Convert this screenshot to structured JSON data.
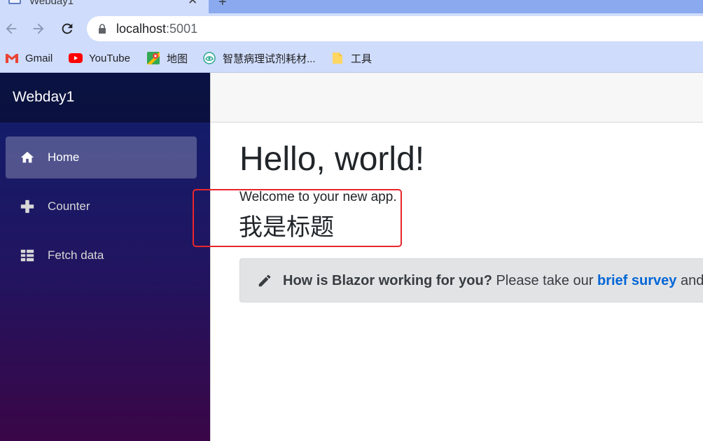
{
  "browser": {
    "tab_title": "Webday1",
    "tab_close": "✕",
    "new_tab": "+",
    "url_host": "localhost",
    "url_port": ":5001",
    "bookmarks": [
      {
        "label": "Gmail",
        "icon": "gmail-icon"
      },
      {
        "label": "YouTube",
        "icon": "youtube-icon"
      },
      {
        "label": "地图",
        "icon": "maps-icon"
      },
      {
        "label": "智慧病理试剂耗材...",
        "icon": "site-icon"
      },
      {
        "label": "工具",
        "icon": "folder-icon"
      }
    ]
  },
  "app": {
    "brand": "Webday1",
    "nav": [
      {
        "label": "Home",
        "icon": "home-icon",
        "active": true
      },
      {
        "label": "Counter",
        "icon": "plus-icon",
        "active": false
      },
      {
        "label": "Fetch data",
        "icon": "list-icon",
        "active": false
      }
    ]
  },
  "content": {
    "heading": "Hello, world!",
    "welcome": "Welcome to your new app.",
    "cn_title": "我是标题",
    "survey": {
      "question": "How is Blazor working for you?",
      "prompt": " Please take our ",
      "link": "brief survey",
      "tail": " and"
    }
  },
  "colors": {
    "highlight_box": "#e8262b",
    "link": "#0366d6",
    "sidebar_top": "#0f1f6e",
    "sidebar_bottom": "#3a0647"
  }
}
